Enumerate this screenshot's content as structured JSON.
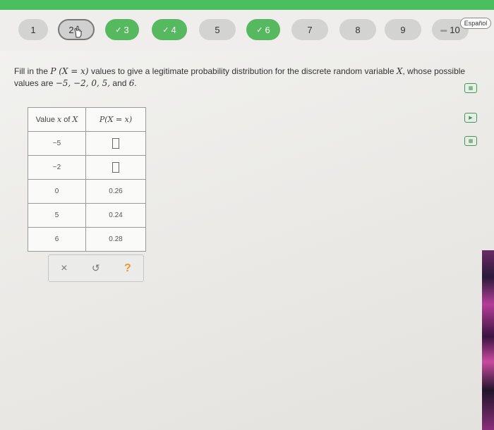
{
  "nav": {
    "steps": [
      {
        "label": "1",
        "state": "plain"
      },
      {
        "label": "2",
        "state": "current"
      },
      {
        "label": "3",
        "state": "done"
      },
      {
        "label": "4",
        "state": "done"
      },
      {
        "label": "5",
        "state": "plain"
      },
      {
        "label": "6",
        "state": "done"
      },
      {
        "label": "7",
        "state": "plain"
      },
      {
        "label": "8",
        "state": "plain"
      },
      {
        "label": "9",
        "state": "plain"
      },
      {
        "label": "10",
        "state": "plain"
      }
    ],
    "language_label": "Español",
    "check_icon": "check-icon"
  },
  "question": {
    "part1": "Fill in the ",
    "math1": "P (X = x)",
    "part2": " values to give a legitimate probability distribution for the discrete random variable ",
    "math2": "X",
    "part3": ", whose possible values are ",
    "math3": "−5, −2, 0, 5,",
    "part4": " and ",
    "math4": "6",
    "part5": "."
  },
  "table": {
    "header_x_prefix": "Value ",
    "header_x_math": "x",
    "header_x_mid": " of ",
    "header_x_var": "X",
    "header_p": "P(X = x)",
    "rows": [
      {
        "x": "−5",
        "p": ""
      },
      {
        "x": "−2",
        "p": ""
      },
      {
        "x": "0",
        "p": "0.26"
      },
      {
        "x": "5",
        "p": "0.24"
      },
      {
        "x": "6",
        "p": "0.28"
      }
    ]
  },
  "actions": {
    "clear": "×",
    "undo": "↺",
    "help": "?"
  },
  "colors": {
    "accent_green": "#4bbf5f",
    "done_step": "#56b85f",
    "help_orange": "#e39b2e"
  }
}
